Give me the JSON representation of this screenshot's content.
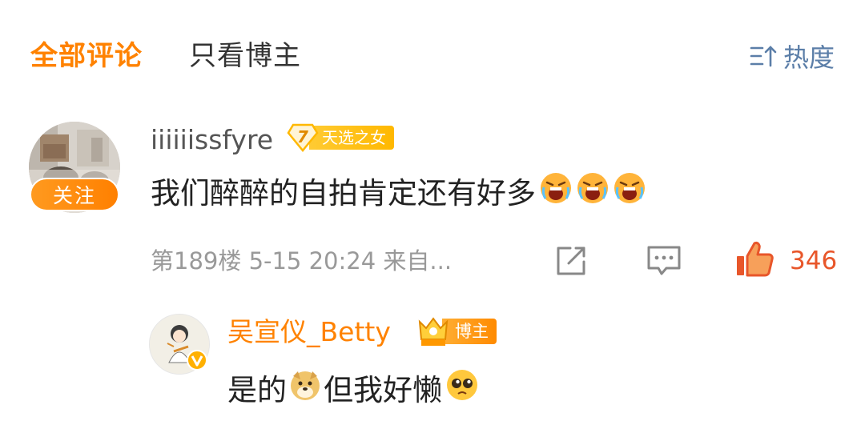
{
  "header": {
    "tab_all": "全部评论",
    "tab_blogger_only": "只看博主",
    "sort_label": "热度",
    "sort_icon": "sort-icon"
  },
  "comment": {
    "username": "iiiiiissfyre",
    "level": "7",
    "badge": "天选之女",
    "follow_label": "关注",
    "text": "我们醉醉的自拍肯定还有好多",
    "emojis": [
      "crying-face",
      "crying-face",
      "crying-face"
    ],
    "meta": "第189楼  5-15 20:24  来自...",
    "like_count": "346"
  },
  "reply": {
    "username": "吴宣仪_Betty",
    "badge": "博主",
    "text_part1": "是的",
    "text_part2": "但我好懒",
    "emojis": [
      "doge",
      "pleading-face"
    ]
  },
  "colors": {
    "accent": "#ff8200",
    "like": "#e8562a",
    "sort": "#5b7ea8",
    "muted": "#999999"
  }
}
